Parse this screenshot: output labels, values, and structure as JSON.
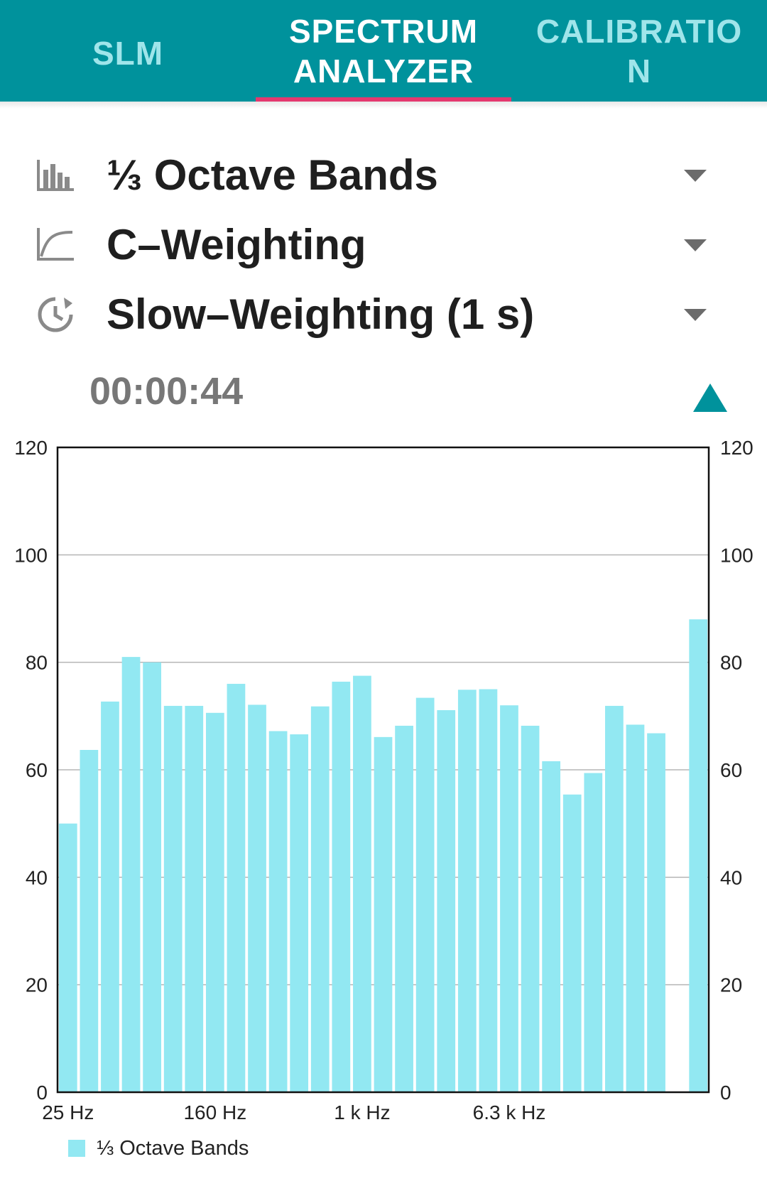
{
  "tabs": [
    {
      "label": "SLM"
    },
    {
      "label": "SPECTRUM\nANALYZER"
    },
    {
      "label": "CALIBRATIO\nN"
    }
  ],
  "options": {
    "band": {
      "label": "⅓ Octave Bands",
      "icon": "bar-chart-icon"
    },
    "frequency_weighting": {
      "label": "C–Weighting",
      "icon": "curve-chart-icon"
    },
    "time_weighting": {
      "label": "Slow–Weighting (1 s)",
      "icon": "history-clock-icon"
    }
  },
  "timer": "00:00:44",
  "colors": {
    "accent": "#00929c",
    "tab_inactive": "#9fe5ea",
    "tab_indicator": "#e4386f",
    "bar": "#92e8f2"
  },
  "chart_data": {
    "type": "bar",
    "x_tick_labels": [
      "25 Hz",
      "160 Hz",
      "1 k Hz",
      "6.3 k Hz"
    ],
    "values": [
      50,
      63.7,
      72.7,
      81,
      80,
      71.9,
      71.9,
      70.6,
      76,
      72.1,
      67.2,
      66.6,
      71.8,
      76.4,
      77.5,
      66.1,
      68.2,
      73.4,
      71.1,
      74.9,
      75,
      72,
      68.2,
      61.6,
      55.4,
      59.4,
      71.9,
      68.4,
      66.8,
      0,
      88
    ],
    "ylim": [
      0,
      120
    ],
    "y_ticks": [
      0,
      20,
      40,
      60,
      80,
      100,
      120
    ],
    "grid": true,
    "legend": {
      "label": "⅓ Octave Bands",
      "position": "bottom-left"
    }
  }
}
